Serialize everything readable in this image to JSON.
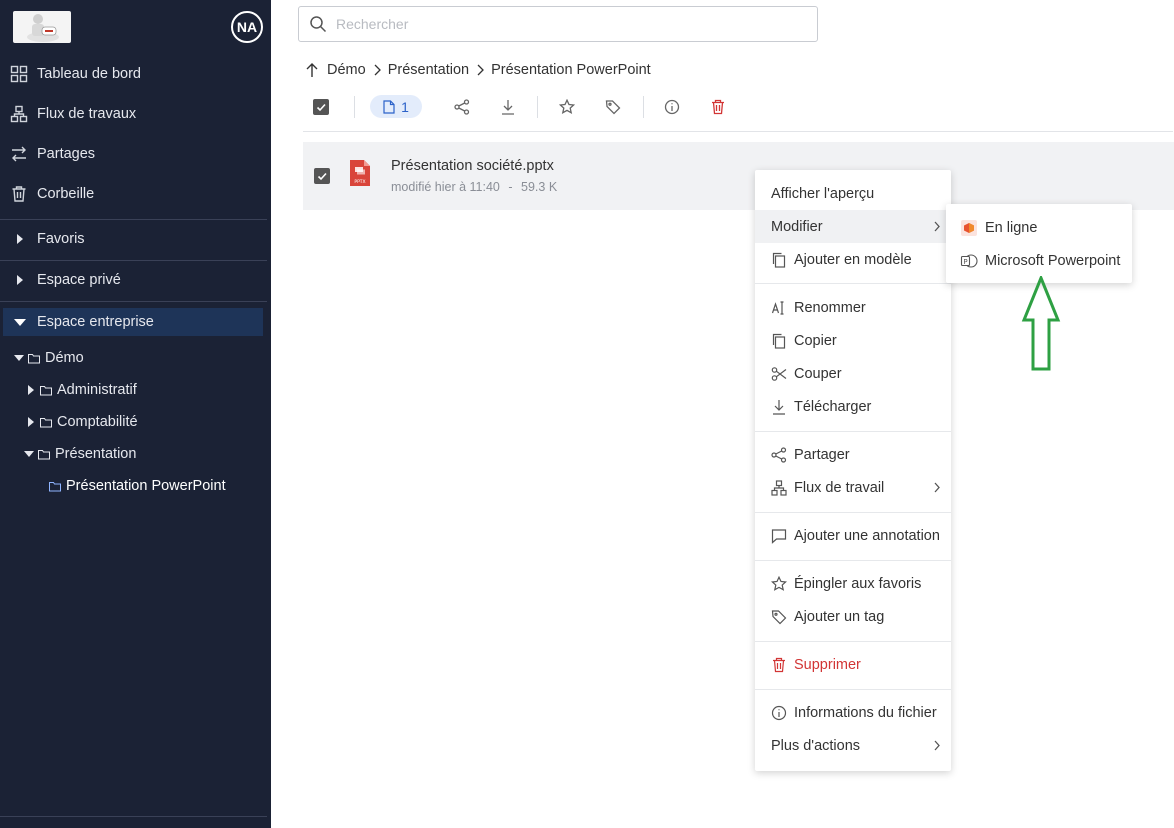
{
  "sidebar": {
    "avatar": "NA",
    "nav": [
      {
        "label": "Tableau de bord",
        "icon": "grid-icon"
      },
      {
        "label": "Flux de travaux",
        "icon": "workflow-icon"
      },
      {
        "label": "Partages",
        "icon": "swap-arrows-icon"
      },
      {
        "label": "Corbeille",
        "icon": "trash-icon"
      }
    ],
    "sections": [
      {
        "label": "Favoris",
        "expanded": false
      },
      {
        "label": "Espace privé",
        "expanded": false
      },
      {
        "label": "Espace entreprise",
        "expanded": true
      }
    ],
    "tree": [
      {
        "label": "Démo",
        "expanded": true
      },
      {
        "label": "Administratif",
        "expanded": false
      },
      {
        "label": "Comptabilité",
        "expanded": false
      },
      {
        "label": "Présentation",
        "expanded": true
      },
      {
        "label": "Présentation PowerPoint",
        "current": true
      }
    ]
  },
  "search": {
    "placeholder": "Rechercher",
    "value": ""
  },
  "breadcrumb": [
    "Démo",
    "Présentation",
    "Présentation PowerPoint"
  ],
  "toolbar": {
    "selected_count": "1"
  },
  "file": {
    "name": "Présentation société.pptx",
    "modified": "modifié hier à 11:40",
    "separator": "-",
    "size": "59.3 K",
    "icon_label": "PPTX"
  },
  "context_menu": {
    "preview": "Afficher l'aperçu",
    "edit": "Modifier",
    "add_template": "Ajouter en modèle",
    "rename": "Renommer",
    "copy": "Copier",
    "cut": "Couper",
    "download": "Télécharger",
    "share": "Partager",
    "workflow": "Flux de travail",
    "annotate": "Ajouter une annotation",
    "pin": "Épingler aux favoris",
    "tag": "Ajouter un tag",
    "delete": "Supprimer",
    "info": "Informations du fichier",
    "more": "Plus d'actions"
  },
  "submenu": {
    "online": "En ligne",
    "desktop": "Microsoft Powerpoint"
  },
  "colors": {
    "sidebar_bg": "#1b2235",
    "active_section": "#1e3458",
    "accent": "#2c62c9",
    "danger": "#d23535",
    "annotation_arrow": "#2ea043"
  }
}
